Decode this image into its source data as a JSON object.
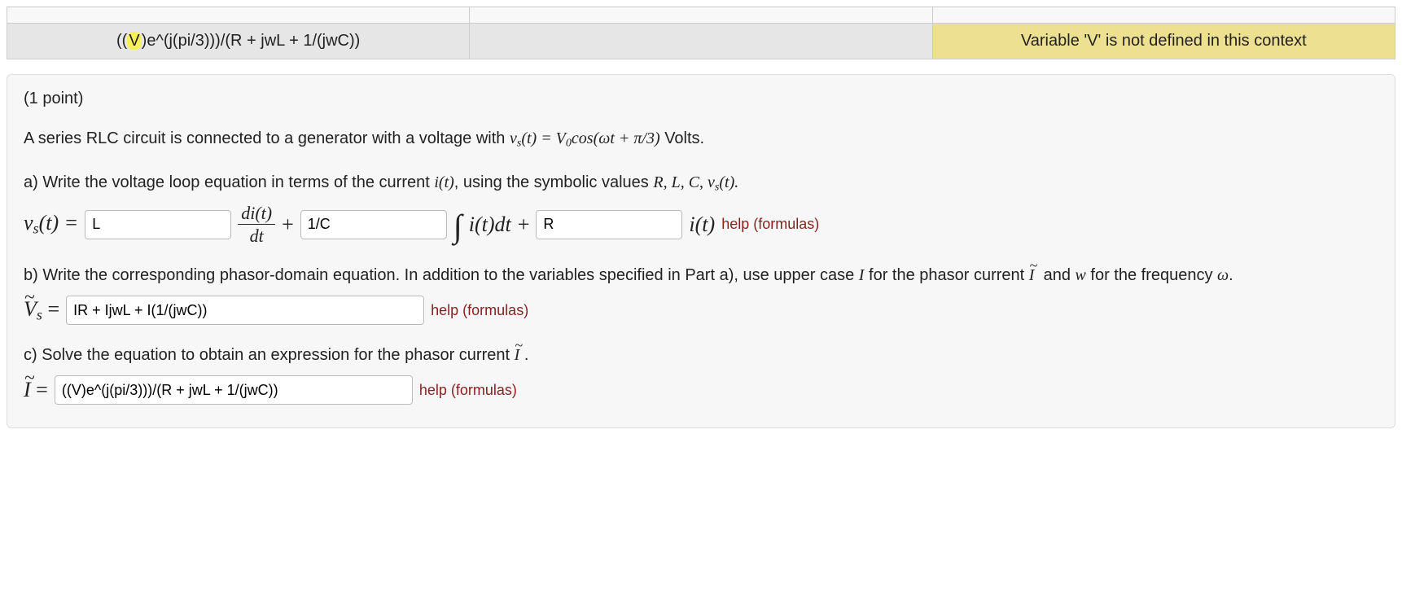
{
  "feedback": {
    "entered_prefix": "((",
    "entered_highlight": "V",
    "entered_suffix": ")e^(j(pi/3)))/(R + jwL + 1/(jwC))",
    "preview": "",
    "result": "Variable 'V' is not defined in this context"
  },
  "problem": {
    "points_label": "(1 point)",
    "intro_pre": "A series RLC circuit is connected to a generator with a voltage with ",
    "intro_vs": "v",
    "intro_vs_sub": "s",
    "intro_vs_arg": "(t) = V",
    "intro_V0sub": "0",
    "intro_cos": "cos(ωt + π/3)",
    "intro_post": " Volts.",
    "a_text_pre": "a) Write the voltage loop equation in terms of the current ",
    "a_it": "i(t)",
    "a_text_mid": ", using the symbolic values ",
    "a_syms": "R, L, C, v",
    "a_syms_sub": "s",
    "a_syms_post": "(t).",
    "a_eq_lhs_v": "v",
    "a_eq_lhs_sub": "s",
    "a_eq_lhs_arg": "(t) =",
    "a_input1": "L",
    "a_frac_num": "di(t)",
    "a_frac_den": "dt",
    "a_plus": "+",
    "a_input2": "1/C",
    "a_int_rhs": "i(t)dt",
    "a_plus2": "+",
    "a_input3": "R",
    "a_tail": "i(t)",
    "a_help": "help (formulas)",
    "b_text_pre": "b) Write the corresponding phasor-domain equation. In addition to the variables specified in Part a), use upper case ",
    "b_I": "I",
    "b_text_mid": " for the phasor current ",
    "b_Itilde": "I",
    "b_text_mid2": " and ",
    "b_w": "w",
    "b_text_mid3": " for the frequency ",
    "b_omega": "ω",
    "b_text_post": ".",
    "b_eq_lhs_V": "V",
    "b_eq_lhs_sub": "s",
    "b_eq_eq": " =",
    "b_input": "IR + IjwL + I(1/(jwC))",
    "b_help": "help (formulas)",
    "c_text_pre": "c) Solve the equation to obtain an expression for the phasor current ",
    "c_Itilde": "I",
    "c_text_post": ".",
    "c_eq_lhs": "I",
    "c_eq_eq": " =",
    "c_input": "((V)e^(j(pi/3)))/(R + jwL + 1/(jwC))",
    "c_help": "help (formulas)"
  }
}
